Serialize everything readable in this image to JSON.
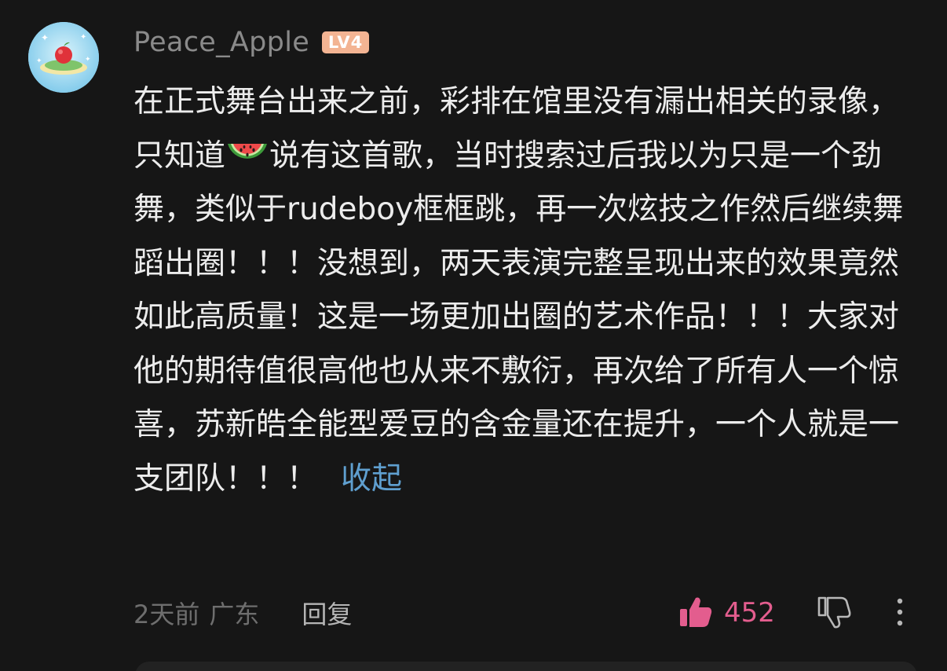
{
  "comment": {
    "username": "Peace_Apple",
    "level": "LV4",
    "text": "在正式舞台出来之前，彩排在馆里没有漏出相关的录像，只知道",
    "text_after_emoji": "说有这首歌，当时搜索过后我以为只是一个劲舞，类似于rudeboy框框跳，再一次炫技之作然后继续舞蹈出圈！！！没想到，两天表演完整呈现出来的效果竟然如此高质量！这是一场更加出圈的艺术作品！！！大家对他的期待值很高他也从来不敷衍，再次给了所有人一个惊喜，苏新皓全能型爱豆的含金量还在提升，一个人就是一支团队！！！",
    "collapse_label": "收起",
    "emoji": "watermelon-emoji",
    "time": "2天前",
    "region": "广东",
    "reply_label": "回复",
    "like_count": "452"
  },
  "icons": {
    "avatar": "apple-island-avatar",
    "like": "thumbs-up-icon",
    "dislike": "thumbs-down-icon",
    "more": "more-vertical-icon"
  },
  "colors": {
    "background": "#161616",
    "text": "#ececec",
    "username": "#8a8a8a",
    "level_badge": "#f3b493",
    "collapse_link": "#5f9fcf",
    "like_active": "#e35d8e",
    "meta": "#6e6e6e"
  }
}
